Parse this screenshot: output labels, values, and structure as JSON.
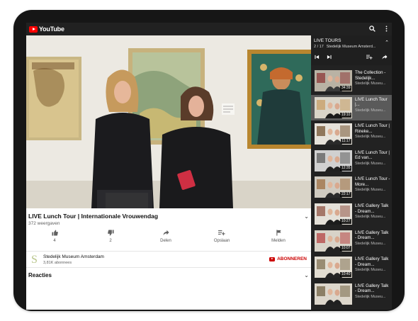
{
  "app": {
    "logo_text": "YouTube"
  },
  "topbar": {
    "search_icon": "search-icon",
    "more_icon": "more-vert-icon"
  },
  "video": {
    "title": "LIVE Lunch Tour | Internationale Vrouwendag",
    "views": "372 weergaven"
  },
  "actions": {
    "like": {
      "icon": "thumbs-up-icon",
      "label": "4"
    },
    "dislike": {
      "icon": "thumbs-down-icon",
      "label": "2"
    },
    "share": {
      "icon": "share-icon",
      "label": "Delen"
    },
    "save": {
      "icon": "playlist-add-icon",
      "label": "Opslaan"
    },
    "report": {
      "icon": "flag-icon",
      "label": "Melden"
    }
  },
  "channel": {
    "avatar_letter": "S",
    "name": "Stedelijk Museum Amsterdam",
    "subscribers": "3,81K abonnees",
    "subscribe_label": "ABONNEREN"
  },
  "comments": {
    "title": "Reacties"
  },
  "playlist": {
    "title": "LIVE TOURS",
    "position": "2 / 17",
    "channel": "Stedelijk Museum Amsterd...",
    "items": [
      {
        "title": "The Collection - Stedelijk...",
        "channel": "Stedelijk Museu...",
        "duration": "34:39"
      },
      {
        "title": "LIVE Lunch Tour |...",
        "channel": "Stedelijk Museu...",
        "duration": "19:10"
      },
      {
        "title": "LIVE Lunch Tour | Rineke...",
        "channel": "Stedelijk Museu...",
        "duration": "11:17"
      },
      {
        "title": "LIVE Lunch Tour | Ed van...",
        "channel": "Stedelijk Museu...",
        "duration": "12:35"
      },
      {
        "title": "LIVE Lunch Tour - More...",
        "channel": "Stedelijk Museu...",
        "duration": "22:17"
      },
      {
        "title": "LIVE Gallery Talk - Dream...",
        "channel": "Stedelijk Museu...",
        "duration": "10:27"
      },
      {
        "title": "LIVE Gallery Talk - Dream...",
        "channel": "Stedelijk Museu...",
        "duration": "10:07"
      },
      {
        "title": "LIVE Gallery Talk - Dream...",
        "channel": "Stedelijk Museu...",
        "duration": "10:40"
      },
      {
        "title": "LIVE Gallery Talk - Dream...",
        "channel": "Stedelijk Museu...",
        "duration": ""
      }
    ]
  },
  "colors": {
    "brand_red": "#ff0000",
    "subscribe_red": "#cc0000",
    "dark_bar": "#212121",
    "panel": "#222222"
  }
}
